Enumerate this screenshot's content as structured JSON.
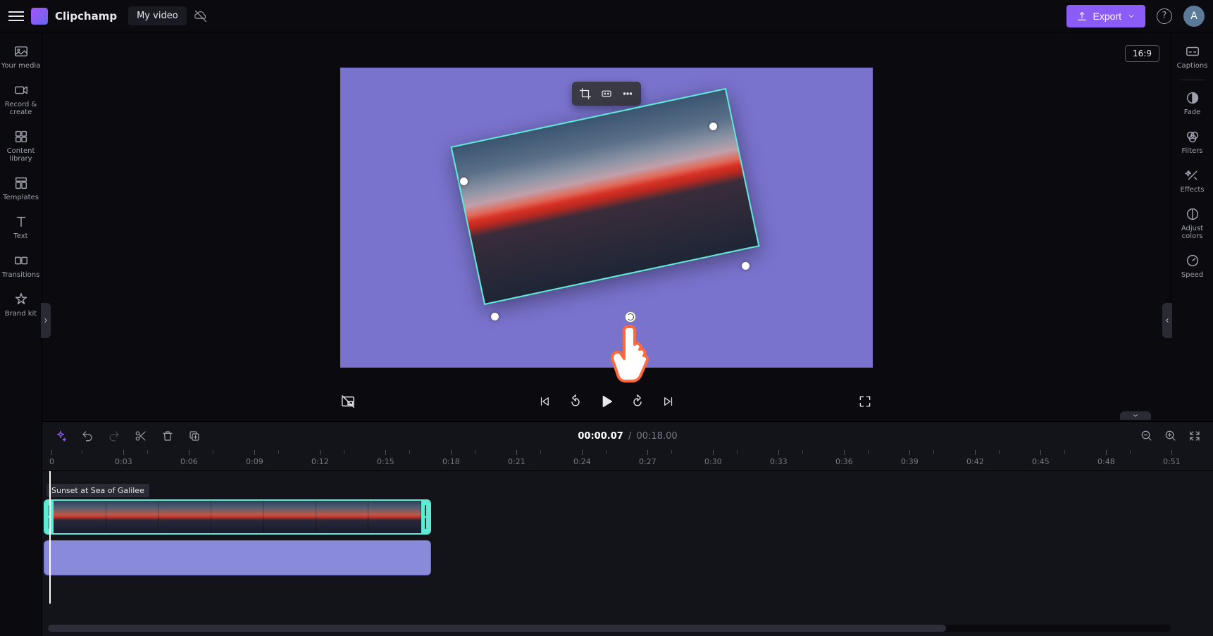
{
  "app": {
    "brand": "Clipchamp",
    "title": "My video"
  },
  "header": {
    "export_label": "Export",
    "aspect_ratio": "16:9",
    "avatar_initial": "A"
  },
  "left_sidebar": {
    "items": [
      {
        "label": "Your media"
      },
      {
        "label": "Record & create"
      },
      {
        "label": "Content library"
      },
      {
        "label": "Templates"
      },
      {
        "label": "Text"
      },
      {
        "label": "Transitions"
      },
      {
        "label": "Brand kit"
      }
    ]
  },
  "right_sidebar": {
    "items": [
      {
        "label": "Captions"
      },
      {
        "label": "Fade"
      },
      {
        "label": "Filters"
      },
      {
        "label": "Effects"
      },
      {
        "label": "Adjust colors"
      },
      {
        "label": "Speed"
      }
    ]
  },
  "playback": {
    "current_time": "00:00.07",
    "duration": "00:18.00"
  },
  "timeline": {
    "clip_label": "Sunset at Sea of Galilee",
    "ruler": [
      {
        "label": "0",
        "pos": 10
      },
      {
        "label": "0:03",
        "pos": 103
      },
      {
        "label": "0:06",
        "pos": 196
      },
      {
        "label": "0:09",
        "pos": 289
      },
      {
        "label": "0:12",
        "pos": 382
      },
      {
        "label": "0:15",
        "pos": 475
      },
      {
        "label": "0:18",
        "pos": 568
      },
      {
        "label": "0:21",
        "pos": 661
      },
      {
        "label": "0:24",
        "pos": 754
      },
      {
        "label": "0:27",
        "pos": 847
      },
      {
        "label": "0:30",
        "pos": 940
      },
      {
        "label": "0:33",
        "pos": 1033
      },
      {
        "label": "0:36",
        "pos": 1126
      },
      {
        "label": "0:39",
        "pos": 1219
      },
      {
        "label": "0:42",
        "pos": 1312
      },
      {
        "label": "0:45",
        "pos": 1405
      },
      {
        "label": "0:48",
        "pos": 1498
      },
      {
        "label": "0:51",
        "pos": 1591
      }
    ]
  }
}
